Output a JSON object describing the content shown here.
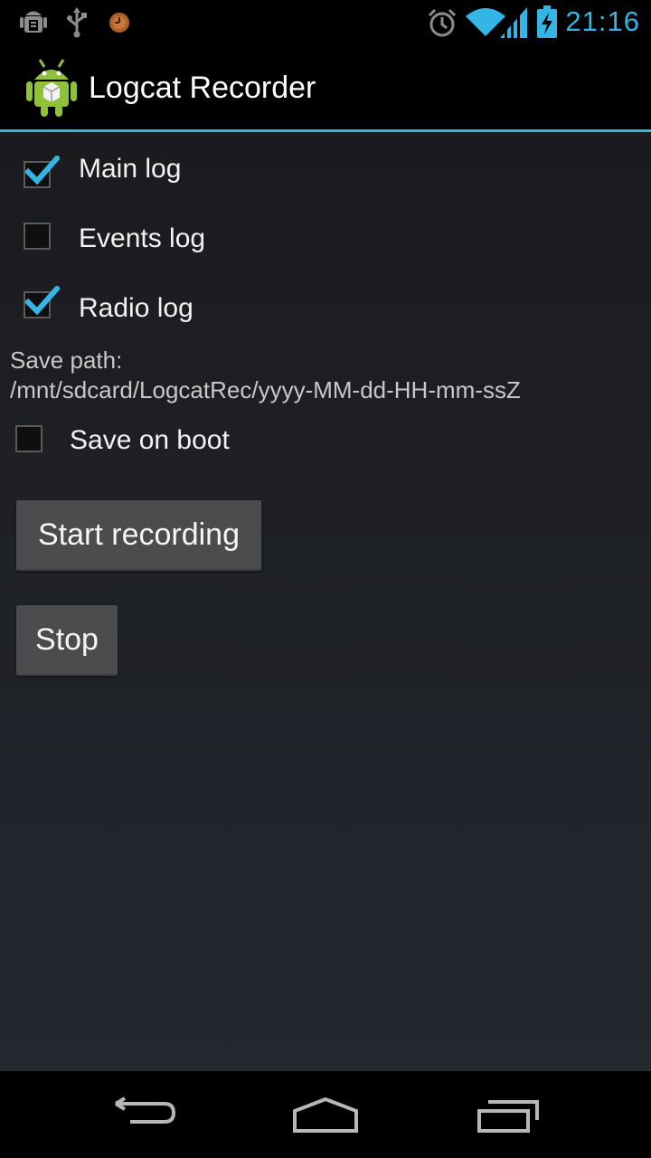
{
  "statusbar": {
    "time": "21:16",
    "left_icons": [
      "debug-android-icon",
      "usb-icon",
      "timer-icon"
    ],
    "right_icons": [
      "alarm-icon",
      "wifi-icon",
      "signal-icon",
      "battery-charging-icon"
    ],
    "accent": "#33b5e5"
  },
  "actionbar": {
    "title": "Logcat Recorder",
    "icon": "android-app-icon"
  },
  "options": [
    {
      "label": "Main log",
      "checked": true
    },
    {
      "label": "Events log",
      "checked": false
    },
    {
      "label": "Radio log",
      "checked": true
    }
  ],
  "save_path": {
    "label": "Save path:",
    "value": "/mnt/sdcard/LogcatRec/yyyy-MM-dd-HH-mm-ssZ"
  },
  "save_on_boot": {
    "label": "Save on boot",
    "checked": false
  },
  "buttons": {
    "start": "Start recording",
    "stop": "Stop"
  },
  "navbar": {
    "icons": [
      "back-icon",
      "home-icon",
      "recent-apps-icon"
    ]
  }
}
